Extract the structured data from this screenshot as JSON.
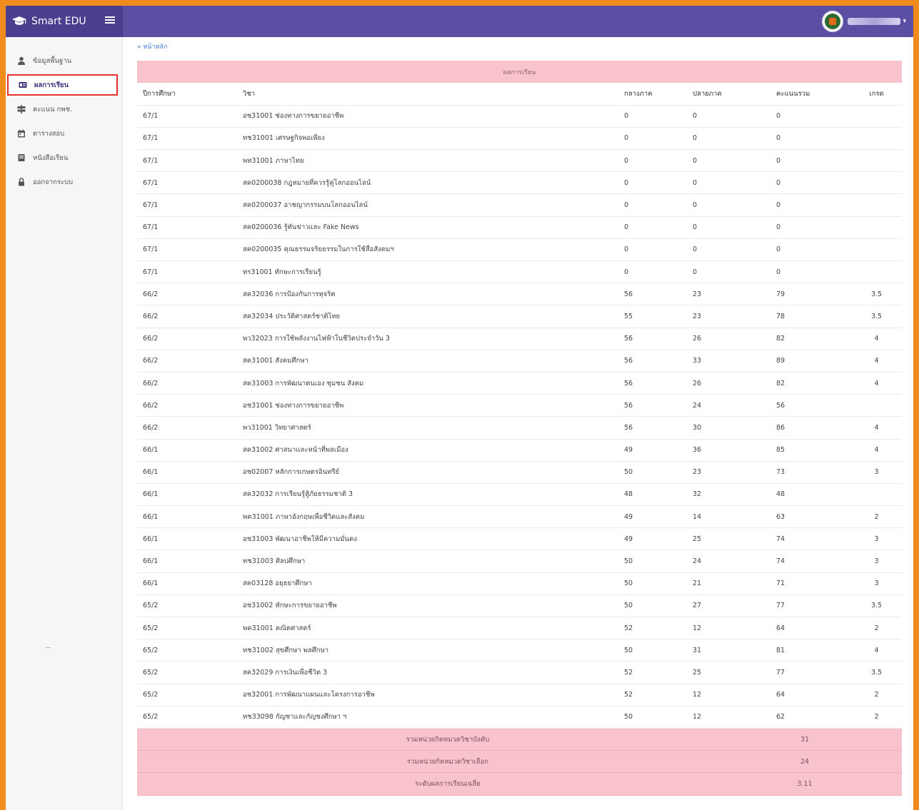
{
  "app": {
    "title": "Smart EDU",
    "menu_icon": "hamburger-icon",
    "brand_icon": "graduation-cap-icon",
    "primary_color": "#5b4fa3",
    "accent_color": "#f9c3cd",
    "highlight_border": "#e5322d"
  },
  "sidebar": {
    "items": [
      {
        "label": "ข้อมูลพื้นฐาน",
        "icon": "user-icon"
      },
      {
        "label": "ผลการเรียน",
        "icon": "id-card-icon",
        "active": true
      },
      {
        "label": "คะแนน กพช.",
        "icon": "signpost-icon"
      },
      {
        "label": "ตารางสอบ",
        "icon": "calendar-icon"
      },
      {
        "label": "หนังสือเรียน",
        "icon": "book-icon"
      },
      {
        "label": "ออกจากระบบ",
        "icon": "lock-icon"
      }
    ]
  },
  "breadcrumb": "« หน้าหลัก",
  "panel": {
    "title": "ผลการเรียน",
    "headers": {
      "term": "ปีการศึกษา",
      "subject": "วิชา",
      "midterm": "กลางภาค",
      "final": "ปลายภาค",
      "total": "คะแนนรวม",
      "grade": "เกรด"
    },
    "rows": [
      {
        "term": "67/1",
        "subject": "อช31001 ช่องทางการขยายอาชีพ",
        "midterm": "0",
        "final": "0",
        "total": "0",
        "grade": ""
      },
      {
        "term": "67/1",
        "subject": "ทช31001 เศรษฐกิจพอเพียง",
        "midterm": "0",
        "final": "0",
        "total": "0",
        "grade": ""
      },
      {
        "term": "67/1",
        "subject": "พท31001 ภาษาไทย",
        "midterm": "0",
        "final": "0",
        "total": "0",
        "grade": ""
      },
      {
        "term": "67/1",
        "subject": "สค0200038 กฎหมายที่ควรรู้คู่โลกออนไลน์",
        "midterm": "0",
        "final": "0",
        "total": "0",
        "grade": ""
      },
      {
        "term": "67/1",
        "subject": "สค0200037 อาชญากรรมบนโลกออนไลน์",
        "midterm": "0",
        "final": "0",
        "total": "0",
        "grade": ""
      },
      {
        "term": "67/1",
        "subject": "สค0200036 รู้ทันข่าวและ Fake News",
        "midterm": "0",
        "final": "0",
        "total": "0",
        "grade": ""
      },
      {
        "term": "67/1",
        "subject": "สค0200035 คุณธรรมจริยธรรมในการใช้สื่อสังคมฯ",
        "midterm": "0",
        "final": "0",
        "total": "0",
        "grade": ""
      },
      {
        "term": "67/1",
        "subject": "ทร31001 ทักษะการเรียนรู้",
        "midterm": "0",
        "final": "0",
        "total": "0",
        "grade": ""
      },
      {
        "term": "66/2",
        "subject": "สค32036 การป้องกันการทุจริต",
        "midterm": "56",
        "final": "23",
        "total": "79",
        "grade": "3.5"
      },
      {
        "term": "66/2",
        "subject": "สค32034 ประวัติศาสตร์ชาติไทย",
        "midterm": "55",
        "final": "23",
        "total": "78",
        "grade": "3.5"
      },
      {
        "term": "66/2",
        "subject": "พว32023 การใช้พลังงานไฟฟ้าในชีวิตประจำวัน 3",
        "midterm": "56",
        "final": "26",
        "total": "82",
        "grade": "4"
      },
      {
        "term": "66/2",
        "subject": "สค31001 สังคมศึกษา",
        "midterm": "56",
        "final": "33",
        "total": "89",
        "grade": "4"
      },
      {
        "term": "66/2",
        "subject": "สค31003 การพัฒนาตนเอง ชุมชน สังคม",
        "midterm": "56",
        "final": "26",
        "total": "82",
        "grade": "4"
      },
      {
        "term": "66/2",
        "subject": "อช31001 ช่องทางการขยายอาชีพ",
        "midterm": "56",
        "final": "24",
        "total": "56",
        "grade": ""
      },
      {
        "term": "66/2",
        "subject": "พว31001 วิทยาศาสตร์",
        "midterm": "56",
        "final": "30",
        "total": "86",
        "grade": "4"
      },
      {
        "term": "66/1",
        "subject": "สค31002 ศาสนาและหน้าที่พลเมือง",
        "midterm": "49",
        "final": "36",
        "total": "85",
        "grade": "4"
      },
      {
        "term": "66/1",
        "subject": "อช02007 หลักการเกษตรอินทรีย์",
        "midterm": "50",
        "final": "23",
        "total": "73",
        "grade": "3"
      },
      {
        "term": "66/1",
        "subject": "สค32032 การเรียนรู้สู้ภัยธรรมชาติ 3",
        "midterm": "48",
        "final": "32",
        "total": "48",
        "grade": ""
      },
      {
        "term": "66/1",
        "subject": "พค31001 ภาษาอังกฤษเพื่อชีวิตและสังคม",
        "midterm": "49",
        "final": "14",
        "total": "63",
        "grade": "2"
      },
      {
        "term": "66/1",
        "subject": "อช31003 พัฒนาอาชีพให้มีความมั่นคง",
        "midterm": "49",
        "final": "25",
        "total": "74",
        "grade": "3"
      },
      {
        "term": "66/1",
        "subject": "ทช31003 ศิลปศึกษา",
        "midterm": "50",
        "final": "24",
        "total": "74",
        "grade": "3"
      },
      {
        "term": "66/1",
        "subject": "สค03128 อยุธยาศึกษา",
        "midterm": "50",
        "final": "21",
        "total": "71",
        "grade": "3"
      },
      {
        "term": "65/2",
        "subject": "อช31002 ทักษะการขยายอาชีพ",
        "midterm": "50",
        "final": "27",
        "total": "77",
        "grade": "3.5"
      },
      {
        "term": "65/2",
        "subject": "พค31001 คณิตศาสตร์",
        "midterm": "52",
        "final": "12",
        "total": "64",
        "grade": "2"
      },
      {
        "term": "65/2",
        "subject": "ทช31002 สุขศึกษา พลศึกษา",
        "midterm": "50",
        "final": "31",
        "total": "81",
        "grade": "4"
      },
      {
        "term": "65/2",
        "subject": "สค32029 การเงินเพื่อชีวิต 3",
        "midterm": "52",
        "final": "25",
        "total": "77",
        "grade": "3.5"
      },
      {
        "term": "65/2",
        "subject": "อช32001 การพัฒนาแผนและโครงการอาชีพ",
        "midterm": "52",
        "final": "12",
        "total": "64",
        "grade": "2"
      },
      {
        "term": "65/2",
        "subject": "ทช33098 กัญชาและกัญชงศึกษา ฯ",
        "midterm": "50",
        "final": "12",
        "total": "62",
        "grade": "2"
      }
    ],
    "summary": [
      {
        "label": "รวมหน่วยกิตหมวดวิชาบังคับ",
        "value": "31"
      },
      {
        "label": "รวมหน่วยกิตหมวดวิชาเลือก",
        "value": "24"
      },
      {
        "label": "ระดับผลการเรียนเฉลี่ย",
        "value": "3.11"
      }
    ]
  }
}
